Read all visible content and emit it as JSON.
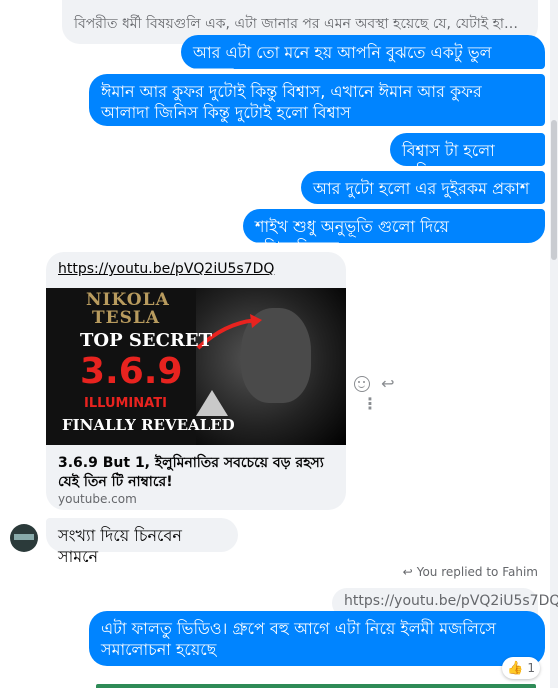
{
  "chat": {
    "quoted_incoming": "বিপরীত ধর্মী বিষয়গুলি এক, এটা জানার পর এমন অবস্থা হয়েছে যে, যেটাই হালাল ...",
    "sent_messages": [
      "আর এটা তো মনে হয় আপনি বুঝতে একটু ভুল হয়েছে",
      "ঈমান আর কুফর দুটোই কিন্তু বিশ্বাস, এখানে ঈমান আর কুফর আলাদা জিনিস কিন্তু দুটোই হলো বিশ্বাস",
      "বিশ্বাস টা হলো অস্তিত্ব",
      "আর দুটো হলো এর দুইরকম প্রকাশ",
      "শাইখ শুধু অনুভূতি গুলো দিয়ে বুঝিয়েছিলেন"
    ],
    "link_card": {
      "url": "https://youtu.be/pVQ2iU5s7DQ",
      "thumbnail": {
        "line1": "NIKOLA",
        "line2": "TESLA",
        "line3": "TOP SECRET",
        "line4": "3.6.9",
        "line5": "ILLUMINATI",
        "line6": "FINALLY REVEALED"
      },
      "title": "3.6.9 But 1, ইলুমিনাতির সবচেয়ে বড় রহস্য যেই তিন টি নাম্বারে!",
      "domain": "youtube.com"
    },
    "incoming_message": "সংখ্যা দিয়ে চিনবেন সামনে",
    "reply_info": "You replied to Fahim",
    "quoted_link": "https://youtu.be/pVQ2iU5s7DQ",
    "reply_message": "এটা ফালতু ভিডিও। গ্রুপে বহু আগে এটা নিয়ে ইলমী মজলিসে সমালোচনা হয়েছে",
    "reaction": {
      "emoji": "👍",
      "count": "1"
    }
  },
  "icons": {
    "react": "smiley-icon",
    "reply": "reply-arrow-icon",
    "more": "more-vertical-icon"
  },
  "colors": {
    "sent_bubble": "#0084ff",
    "received_bubble": "#f0f2f5",
    "secondary_text": "#65676b"
  }
}
